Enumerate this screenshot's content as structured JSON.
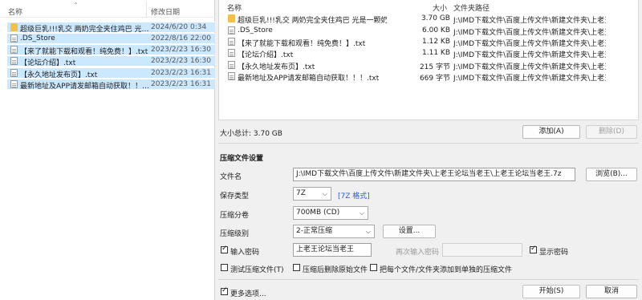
{
  "explorer": {
    "col_name": "名称",
    "col_date": "修改日期",
    "files": [
      {
        "name": "超级巨乳!!!乳交 两奶完全夹住鸡巴 光是...",
        "date": "2024/6/20 0:34",
        "icon": "folder"
      },
      {
        "name": ".DS_Store",
        "date": "2022/8/16 22:00",
        "icon": "file"
      },
      {
        "name": "【来了就能下载和观看！纯免费！】.txt",
        "date": "2023/2/23 16:30",
        "icon": "file"
      },
      {
        "name": "【论坛介绍】.txt",
        "date": "2023/2/23 16:30",
        "icon": "file"
      },
      {
        "name": "【永久地址发布页】.txt",
        "date": "2023/2/23 16:31",
        "icon": "file"
      },
      {
        "name": "最新地址及APP请发邮箱自动获取！！！...",
        "date": "2023/2/23 16:31",
        "icon": "file"
      }
    ]
  },
  "filelist": {
    "col_name": "名称",
    "col_size": "大小",
    "col_path": "文件夹路径",
    "rows": [
      {
        "name": "超级巨乳!!!乳交 两奶完全夹住鸡巴 光是一颗奶就...",
        "size": "3.70 GB",
        "path": "J:\\IMD下载文件\\百度上传文件\\新建文件夹\\上老王...",
        "icon": "folder"
      },
      {
        "name": ".DS_Store",
        "size": "6.00 KB",
        "path": "J:\\IMD下载文件\\百度上传文件\\新建文件夹\\上老王...",
        "icon": "file"
      },
      {
        "name": "【来了就能下载和观看！纯免费！】.txt",
        "size": "1.12 KB",
        "path": "J:\\IMD下载文件\\百度上传文件\\新建文件夹\\上老王...",
        "icon": "file"
      },
      {
        "name": "【论坛介绍】.txt",
        "size": "1.11 KB",
        "path": "J:\\IMD下载文件\\百度上传文件\\新建文件夹\\上老王...",
        "icon": "file"
      },
      {
        "name": "【永久地址发布页】.txt",
        "size": "215 字节",
        "path": "J:\\IMD下载文件\\百度上传文件\\新建文件夹\\上老王...",
        "icon": "file"
      },
      {
        "name": "最新地址及APP请发邮箱自动获取！！！.txt",
        "size": "669 字节",
        "path": "J:\\IMD下载文件\\百度上传文件\\新建文件夹\\上老王...",
        "icon": "file"
      }
    ]
  },
  "summary": {
    "total_size": "大小总计: 3.70 GB",
    "add_label": "添加(A)",
    "delete_label": "删除(D)"
  },
  "settings": {
    "section_title": "压缩文件设置",
    "filename_label": "文件名",
    "filename_value": "J:\\IMD下载文件\\百度上传文件\\新建文件夹\\上老王论坛当老王\\上老王论坛当老王.7z",
    "browse_label": "浏览(B)...",
    "type_label": "保存类型",
    "type_value": "7Z",
    "type_link": "[7Z 格式]",
    "volume_label": "压缩分卷",
    "volume_value": "700MB (CD)",
    "level_label": "压缩级别",
    "level_value": "2-正常压缩",
    "settings_button": "设置...",
    "password_label": "输入密码",
    "password_value": "上老王论坛当老王",
    "repeat_password_label": "再次输入密码",
    "show_password_label": "显示密码",
    "test_label": "测试压缩文件(T)",
    "delete_after_label": "压缩后删除原始文件",
    "separate_label": "把每个文件/文件夹添加到单独的压缩文件",
    "more_options_label": "更多选项...",
    "start_label": "开始(S)",
    "cancel_label": "取消"
  },
  "colors": {
    "selection": "#cce8ff",
    "dialog_bg": "#f0f0f0",
    "link": "#2a5cd6"
  }
}
